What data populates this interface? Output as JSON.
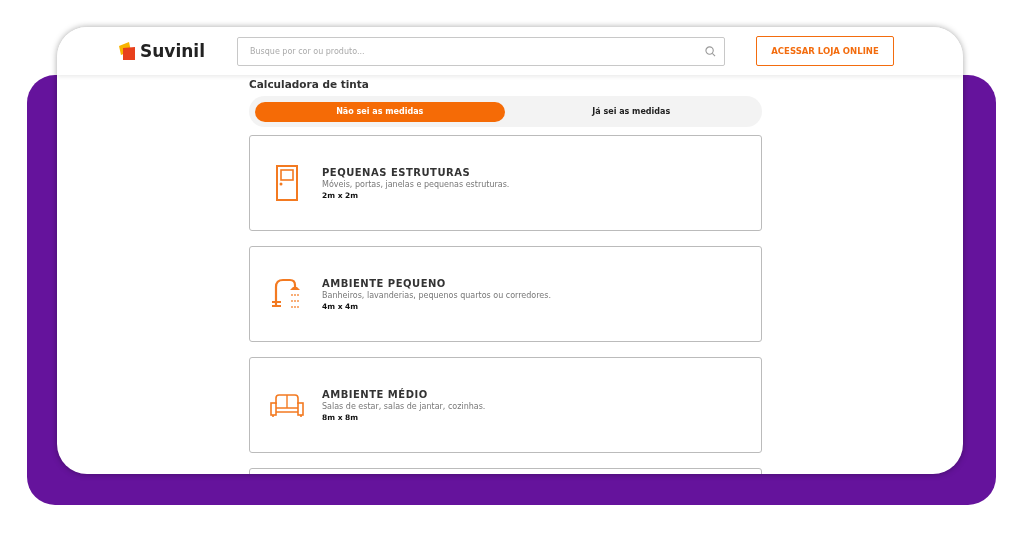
{
  "header": {
    "logo": "Suvinil",
    "search": {
      "placeholder": "Busque por cor ou produto..."
    },
    "store_button": "ACESSAR LOJA ONLINE"
  },
  "page_title": "Calculadora de tinta",
  "tabs": [
    {
      "label": "Não sei as medidas",
      "selected": true
    },
    {
      "label": "Já sei as medidas",
      "selected": false
    }
  ],
  "options": [
    {
      "kind": "door",
      "title": "PEQUENAS ESTRUTURAS",
      "description": "Móveis, portas, janelas e pequenas estruturas.",
      "size": "2m x 2m"
    },
    {
      "kind": "shower",
      "title": "AMBIENTE PEQUENO",
      "description": "Banheiros, lavanderias, pequenos quartos ou corredores.",
      "size": "4m x 4m"
    },
    {
      "kind": "sofa",
      "title": "AMBIENTE MÉDIO",
      "description": "Salas de estar, salas de jantar, cozinhas.",
      "size": "8m x 8m"
    }
  ]
}
